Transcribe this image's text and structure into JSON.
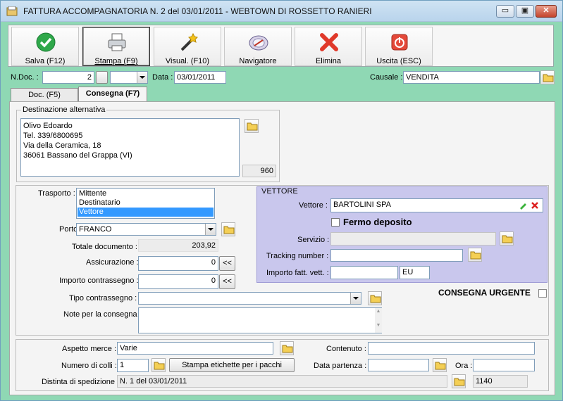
{
  "window": {
    "title": "FATTURA ACCOMPAGNATORIA N. 2  del 03/01/2011 - WEBTOWN DI ROSSETTO RANIERI",
    "minimize": "▭",
    "maximize": "▣",
    "close": "✕"
  },
  "toolbar": {
    "save": "Salva (F12)",
    "print": "Stampa (F9)",
    "view": "Visual. (F10)",
    "navigator": "Navigatore",
    "delete": "Elimina",
    "exit": "Uscita (ESC)"
  },
  "header": {
    "ndoc_label": "N.Doc. :",
    "ndoc_value": "2",
    "data_label": "Data :",
    "data_value": "03/01/2011",
    "causale_label": "Causale :",
    "causale_value": "VENDITA"
  },
  "tabs": {
    "doc": "Doc. (F5)",
    "consegna": "Consegna (F7)"
  },
  "destinazione": {
    "title": "Destinazione alternativa",
    "lines": [
      "Olivo Edoardo",
      "Tel. 339/6800695",
      "Via della Ceramica, 18",
      "36061 Bassano del Grappa (VI)"
    ],
    "code": "960"
  },
  "trasporto": {
    "label": "Trasporto :",
    "options": [
      "Mittente",
      "Destinatario",
      "Vettore"
    ],
    "selected": "Vettore"
  },
  "porto": {
    "label": "Porto :",
    "value": "FRANCO"
  },
  "totale": {
    "label": "Totale documento :",
    "value": "203,92"
  },
  "assicurazione": {
    "label": "Assicurazione :",
    "value": "0",
    "btn": "<<"
  },
  "contrassegno": {
    "label": "Importo contrassegno :",
    "value": "0",
    "btn": "<<"
  },
  "tipo_contrassegno": {
    "label": "Tipo contrassegno :",
    "value": ""
  },
  "note": {
    "label": "Note per la consegna",
    "value": ""
  },
  "vettore_box": {
    "title": "VETTORE",
    "vettore_label": "Vettore :",
    "vettore_value": "BARTOLINI SPA",
    "fermo_label": "Fermo deposito",
    "servizio_label": "Servizio :",
    "tracking_label": "Tracking number :",
    "importo_label": "Importo fatt. vett. :",
    "importo_value": "",
    "currency": "EU"
  },
  "urgente": {
    "label": "CONSEGNA URGENTE"
  },
  "spedizione": {
    "aspetto_label": "Aspetto merce :",
    "aspetto_value": "Varie",
    "contenuto_label": "Contenuto :",
    "contenuto_value": "",
    "colli_label": "Numero di colli :",
    "colli_value": "1",
    "etichette_btn": "Stampa etichette per i pacchi",
    "partenza_label": "Data partenza :",
    "partenza_value": "",
    "ora_label": "Ora :",
    "ora_value": "",
    "distinta_label": "Distinta di spedizione :",
    "distinta_value": "N. 1 del 03/01/2011",
    "distinta_code": "1140"
  }
}
